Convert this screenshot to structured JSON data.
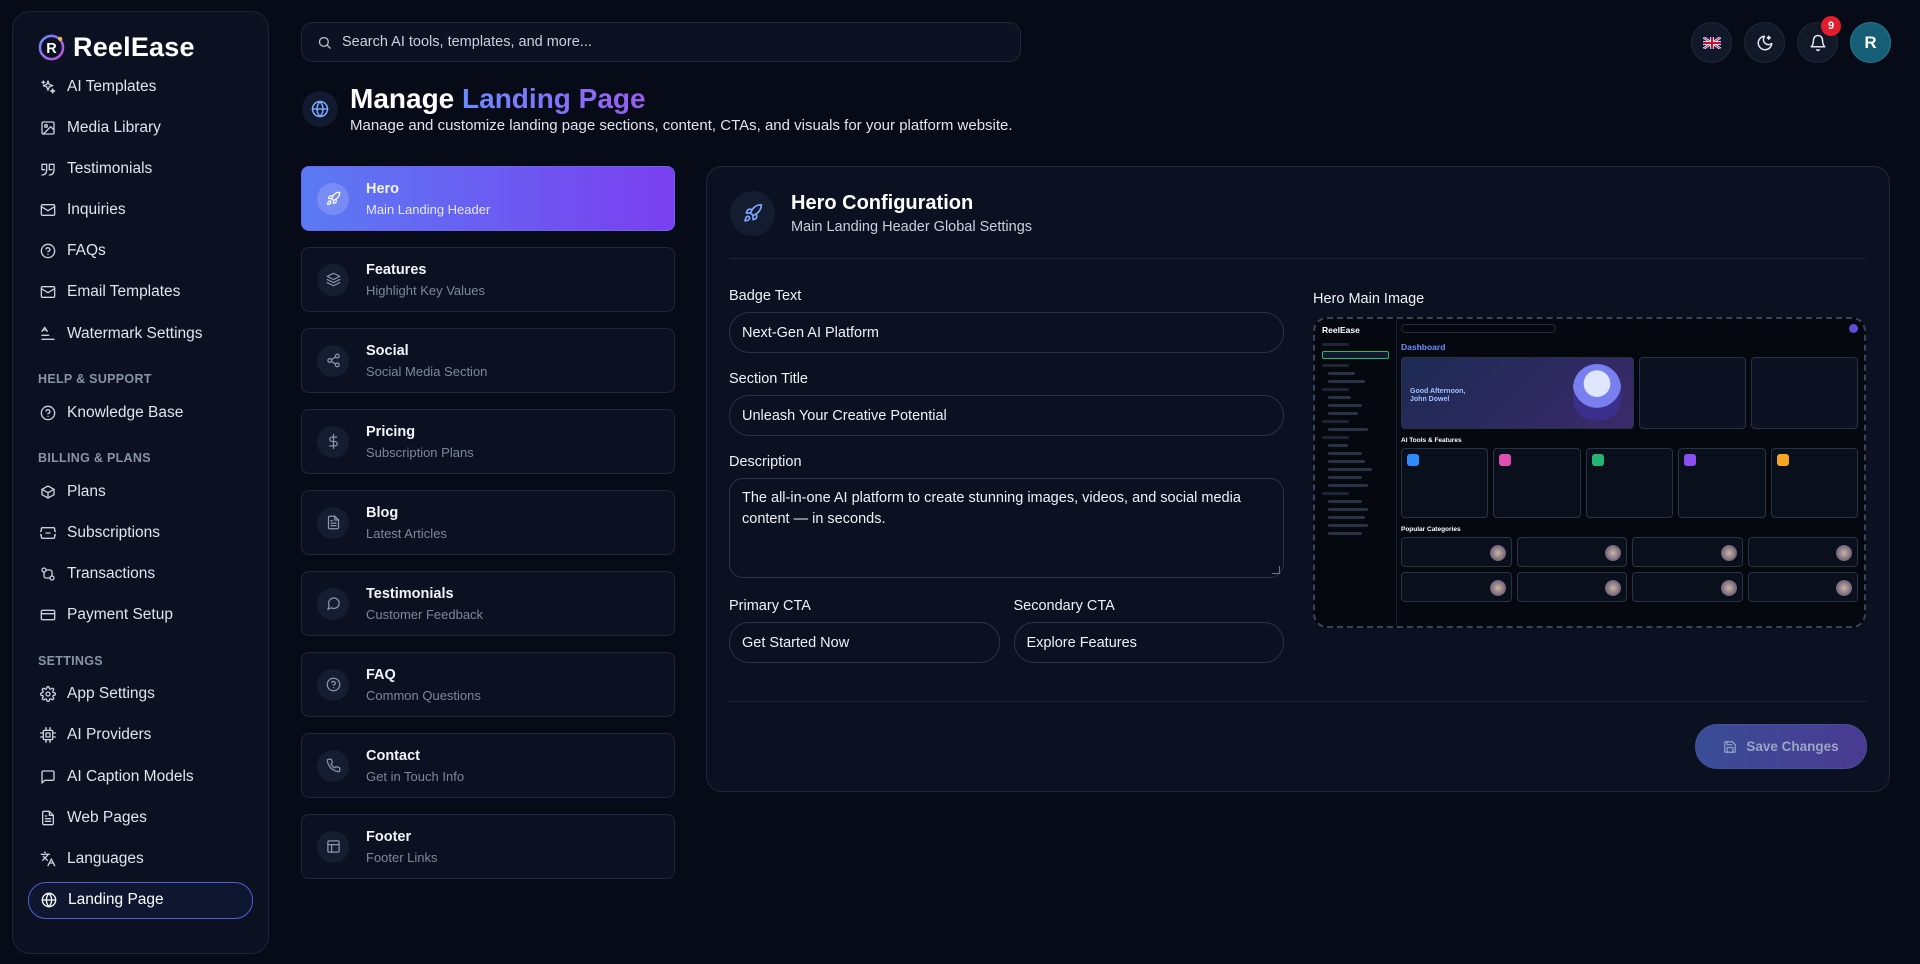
{
  "brand": {
    "name": "ReelEase"
  },
  "sidebar": {
    "items": [
      {
        "label": "AI Templates",
        "icon": "sparkles-icon"
      },
      {
        "label": "Media Library",
        "icon": "image-icon"
      },
      {
        "label": "Testimonials",
        "icon": "quote-icon"
      },
      {
        "label": "Inquiries",
        "icon": "mail-icon"
      },
      {
        "label": "FAQs",
        "icon": "help-circle-icon"
      },
      {
        "label": "Email Templates",
        "icon": "mail-icon"
      },
      {
        "label": "Watermark Settings",
        "icon": "text-align-icon"
      }
    ],
    "help_section": "HELP & SUPPORT",
    "help_items": [
      {
        "label": "Knowledge Base",
        "icon": "help-circle-icon"
      }
    ],
    "billing_section": "BILLING & PLANS",
    "billing_items": [
      {
        "label": "Plans",
        "icon": "box-icon"
      },
      {
        "label": "Subscriptions",
        "icon": "ticket-icon"
      },
      {
        "label": "Transactions",
        "icon": "transfer-icon"
      },
      {
        "label": "Payment Setup",
        "icon": "credit-card-icon"
      }
    ],
    "settings_section": "SETTINGS",
    "settings_items": [
      {
        "label": "App Settings",
        "icon": "gear-icon"
      },
      {
        "label": "AI Providers",
        "icon": "cpu-icon"
      },
      {
        "label": "AI Caption Models",
        "icon": "message-square-icon"
      },
      {
        "label": "Web Pages",
        "icon": "file-text-icon"
      },
      {
        "label": "Languages",
        "icon": "languages-icon"
      },
      {
        "label": "Landing Page",
        "icon": "globe-icon",
        "active": true
      }
    ]
  },
  "search": {
    "placeholder": "Search AI tools, templates, and more..."
  },
  "topbar": {
    "notification_count": "9",
    "avatar_initial": "R",
    "language_flag": "uk-flag-icon"
  },
  "page": {
    "title_prefix": "Manage",
    "title_accent": "Landing Page",
    "subtitle": "Manage and customize landing page sections, content, CTAs, and visuals for your platform website."
  },
  "tabs": [
    {
      "name": "Hero",
      "desc": "Main Landing Header",
      "icon": "rocket-icon",
      "active": true
    },
    {
      "name": "Features",
      "desc": "Highlight Key Values",
      "icon": "layers-icon"
    },
    {
      "name": "Social",
      "desc": "Social Media Section",
      "icon": "share-icon"
    },
    {
      "name": "Pricing",
      "desc": "Subscription Plans",
      "icon": "dollar-icon"
    },
    {
      "name": "Blog",
      "desc": "Latest Articles",
      "icon": "file-text-icon"
    },
    {
      "name": "Testimonials",
      "desc": "Customer Feedback",
      "icon": "message-circle-icon"
    },
    {
      "name": "FAQ",
      "desc": "Common Questions",
      "icon": "help-circle-icon"
    },
    {
      "name": "Contact",
      "desc": "Get in Touch Info",
      "icon": "phone-icon"
    },
    {
      "name": "Footer",
      "desc": "Footer Links",
      "icon": "layout-icon"
    }
  ],
  "panel": {
    "title": "Hero Configuration",
    "subtitle": "Main Landing Header Global Settings",
    "badge_label": "Badge Text",
    "badge_value": "Next-Gen AI Platform",
    "section_title_label": "Section Title",
    "section_title_value": "Unleash Your Creative Potential",
    "description_label": "Description",
    "description_value": "The all-in-one AI platform to create stunning images, videos, and social media content — in seconds.",
    "primary_cta_label": "Primary CTA",
    "primary_cta_value": "Get Started Now",
    "secondary_cta_label": "Secondary CTA",
    "secondary_cta_value": "Explore Features",
    "image_label": "Hero Main Image",
    "save_label": "Save Changes"
  },
  "preview": {
    "brand": "ReelEase",
    "heading": "Dashboard",
    "greeting": "Good Afternoon, John Dowel",
    "tools_heading": "AI Tools & Features",
    "categories_heading": "Popular Categories",
    "tool_colors": [
      "#2f8cff",
      "#e04fb0",
      "#22b573",
      "#8a4ff0",
      "#f5a623"
    ]
  },
  "colors": {
    "accent": "#5b7bf3",
    "accent2": "#7a3ff0",
    "background": "#070b17"
  }
}
